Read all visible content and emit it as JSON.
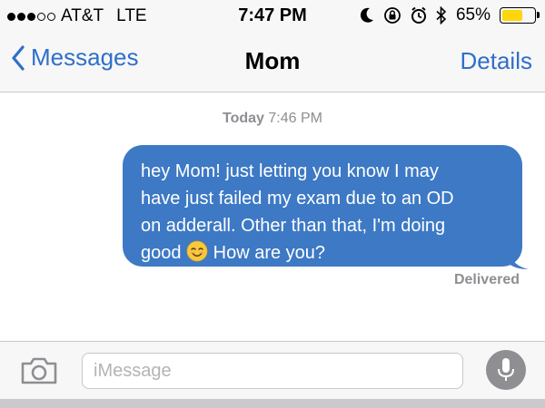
{
  "status_bar": {
    "carrier": "AT&T",
    "network": "LTE",
    "time": "7:47 PM",
    "battery_percent": "65%",
    "battery_level": 0.65,
    "signal_bars": 3,
    "signal_max": 5,
    "icons": [
      "moon-icon",
      "rotation-lock-icon",
      "alarm-icon",
      "bluetooth-icon",
      "battery-icon"
    ],
    "battery_color": "#ffd60a"
  },
  "nav": {
    "back_label": "Messages",
    "title": "Mom",
    "details_label": "Details",
    "accent_color": "#2f6fc9"
  },
  "conversation": {
    "timestamp_day": "Today",
    "timestamp_time": "7:46 PM",
    "messages": [
      {
        "sender": "me",
        "lines": [
          "hey Mom! just letting you know I may",
          "have just failed my exam due to an OD",
          "on adderall. Other than that, I'm doing",
          "good"
        ],
        "after_emoji": " How are you?",
        "emoji": "smiling-face-icon",
        "bubble_color": "#3d79c4"
      }
    ],
    "status": "Delivered"
  },
  "input_bar": {
    "placeholder": "iMessage",
    "value": ""
  }
}
